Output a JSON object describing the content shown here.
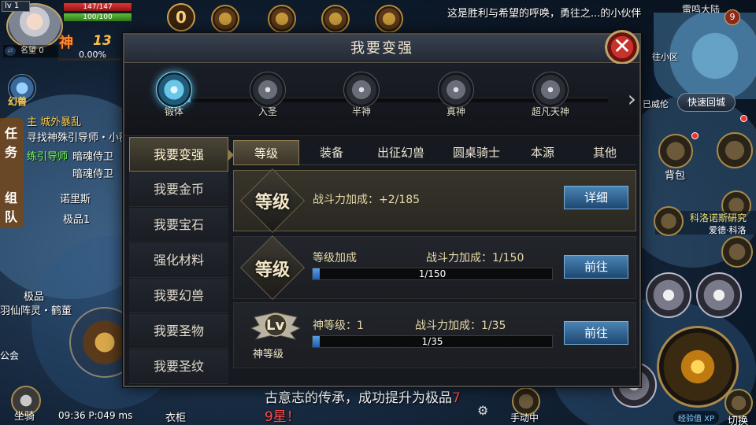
{
  "hud": {
    "level": "1",
    "hp": "147/147",
    "mp": "100/100",
    "god_label": "神",
    "god_power": "13",
    "prestige_label": "名望",
    "prestige_value": "0",
    "exp_pct": "0.00%",
    "zero_badge": "0",
    "news": "这是胜利与希望的呼唤，勇往之...的小伙伴",
    "region": "雷鸣大陆",
    "map_badge": "9",
    "minimap_label": "往小区",
    "minimap_label2": "已威伦",
    "quick_return": "快速回城",
    "bag_label": "背包",
    "npc_name": "科洛诺斯研究",
    "npc_sub": "爱德·科洛",
    "exp_pill": "经验值 XP",
    "switch_label": "切换",
    "phantom_label": "幻兽",
    "side_tabs": [
      "任",
      "务",
      "组",
      "队"
    ],
    "quests": [
      {
        "text": "主 城外暴乱",
        "cls": "quest-gold"
      },
      {
        "text": "寻找神殊引导师・小薇",
        "cls": ""
      },
      {
        "text": "练引导师",
        "cls": "quest-green"
      },
      {
        "text": "暗魂侍卫",
        "cls": ""
      },
      {
        "text": "暗魂侍卫",
        "cls": ""
      },
      {
        "text": "诺里斯",
        "cls": ""
      },
      {
        "text": "极品1",
        "cls": ""
      },
      {
        "text": "极品",
        "cls": ""
      },
      {
        "text": "羽仙阵灵・鹤董",
        "cls": ""
      }
    ],
    "guild_label": "公会",
    "mount_label": "坐骑",
    "status_line": "09:36 P:049 ms",
    "wardrobe_label": "衣柜",
    "ticker_line1": "古意志的传承，成功提升为极品",
    "ticker_red1": "7",
    "ticker_red2": "9星！",
    "manual_label": "手动中"
  },
  "modal": {
    "title": "我要变强",
    "close_label": "✕",
    "stages": [
      "锻体",
      "入圣",
      "半神",
      "真神",
      "超凡天神"
    ],
    "active_stage": 0,
    "sidebar": [
      "我要变强",
      "我要金币",
      "我要宝石",
      "强化材料",
      "我要幻兽",
      "我要圣物",
      "我要圣纹"
    ],
    "active_sidebar": 0,
    "tabs": [
      "等级",
      "装备",
      "出征幻兽",
      "圆桌骑士",
      "本源",
      "其他"
    ],
    "active_tab": 0,
    "row1": {
      "emblem": "等级",
      "text": "战斗力加成：+2/185",
      "button": "详细"
    },
    "row2": {
      "emblem": "等级",
      "label": "等级加成",
      "power": "战斗力加成：1/150",
      "progress_text": "1/150",
      "progress": 0.0067,
      "button": "前往"
    },
    "row3": {
      "emblem": "Lv",
      "caption": "神等级",
      "label": "神等级：1",
      "power": "战斗力加成：1/35",
      "progress_text": "1/35",
      "progress": 0.0286,
      "button": "前往"
    }
  }
}
